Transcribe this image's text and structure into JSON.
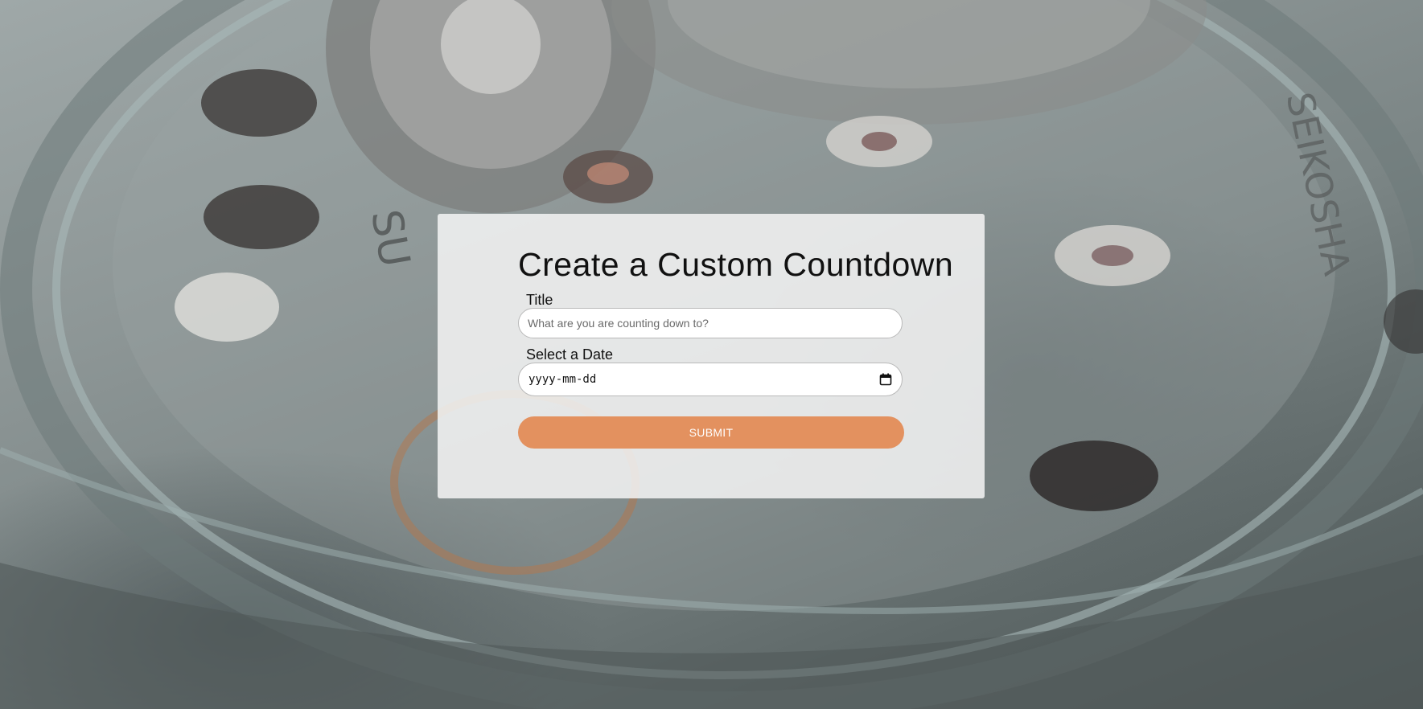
{
  "background": {
    "subject": "watch-movement-photo",
    "engravings": [
      "SU",
      "SEIKOSHA"
    ]
  },
  "form": {
    "title": "Create a Custom Countdown",
    "title_field": {
      "label": "Title",
      "value": "",
      "placeholder": "What are you are counting down to?"
    },
    "date_field": {
      "label": "Select a Date",
      "placeholder": "yyyy-mm-dd",
      "icon": "calendar-icon"
    },
    "submit_label": "SUBMIT"
  },
  "colors": {
    "accent": "#e3915f",
    "card_background": "#f5f5f5"
  }
}
